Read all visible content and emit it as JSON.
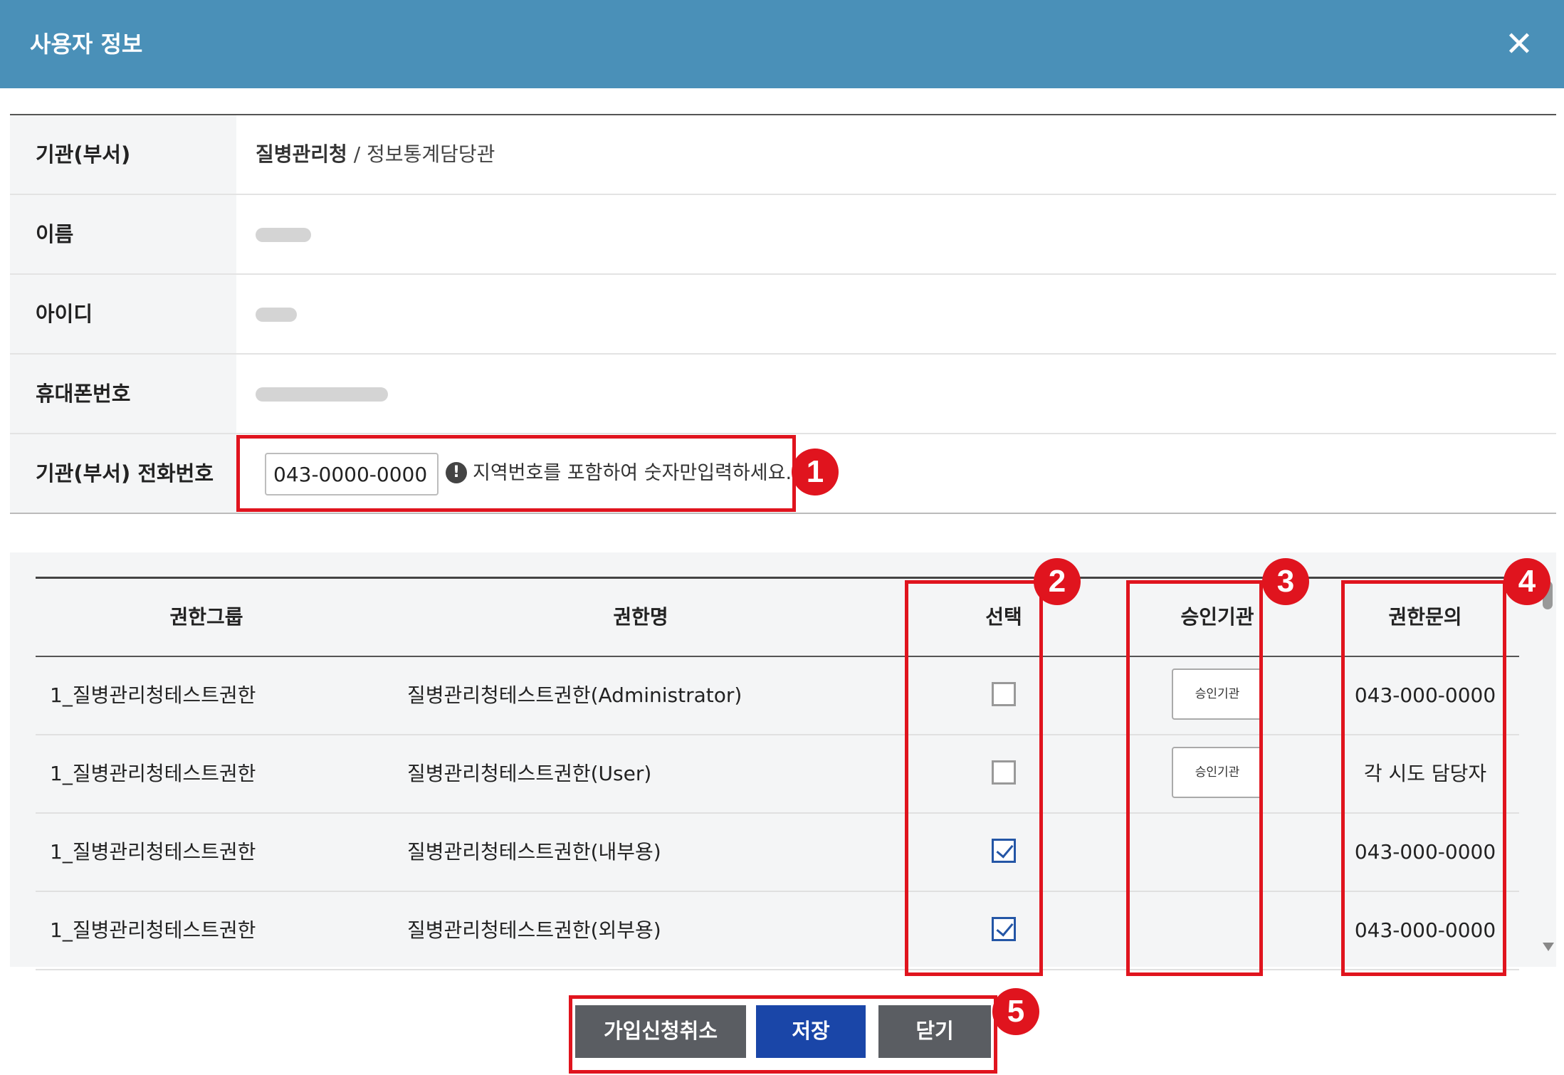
{
  "dialog": {
    "title": "사용자 정보",
    "close_icon": "✕"
  },
  "info": {
    "org_label": "기관(부서)",
    "org_name": "질병관리청",
    "org_separator": " / ",
    "dept_name": "정보통계담당관",
    "name_label": "이름",
    "id_label": "아이디",
    "mobile_label": "휴대폰번호",
    "phone_label": "기관(부서) 전화번호",
    "phone_value": "043-0000-0000",
    "phone_hint": "지역번호를 포함하여 숫자만입력하세요.",
    "warn_icon": "!"
  },
  "permissions": {
    "headers": {
      "group": "권한그룹",
      "name": "권한명",
      "select": "선택",
      "approver": "승인기관",
      "inquiry": "권한문의"
    },
    "approver_button_label": "승인기관",
    "rows": [
      {
        "group": "1_질병관리청테스트권한",
        "name": "질병관리청테스트권한(Administrator)",
        "checked": false,
        "inquiry": "043-000-0000"
      },
      {
        "group": "1_질병관리청테스트권한",
        "name": "질병관리청테스트권한(User)",
        "checked": false,
        "inquiry": "각 시도 담당자"
      },
      {
        "group": "1_질병관리청테스트권한",
        "name": "질병관리청테스트권한(내부용)",
        "checked": true,
        "inquiry": "043-000-0000"
      },
      {
        "group": "1_질병관리청테스트권한",
        "name": "질병관리청테스트권한(외부용)",
        "checked": true,
        "inquiry": "043-000-0000"
      }
    ]
  },
  "footer": {
    "cancel_label": "가입신청취소",
    "save_label": "저장",
    "close_label": "닫기"
  },
  "annotations": {
    "marker_color": "#e0141e",
    "labels": [
      "1",
      "2",
      "3",
      "4",
      "5"
    ]
  }
}
